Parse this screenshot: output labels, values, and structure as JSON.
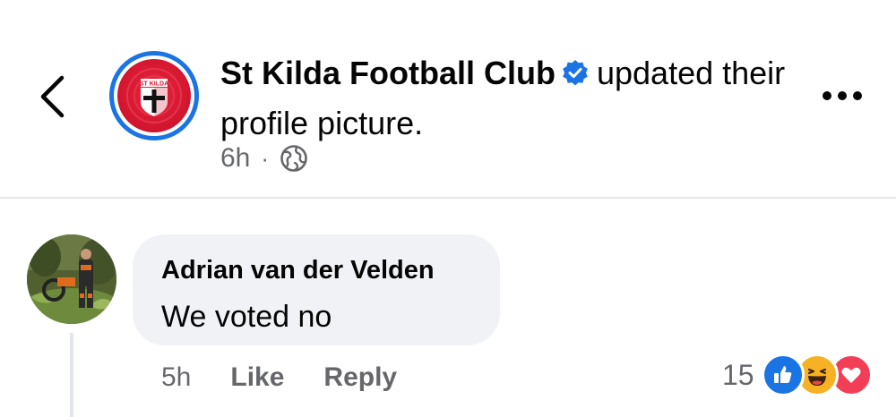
{
  "post_header": {
    "page_name": "St Kilda Football Club",
    "action_text": "updated their profile picture.",
    "timestamp": "6h",
    "separator": "·",
    "privacy_icon": "globe-icon",
    "verified_icon": "verified-badge-icon",
    "back_icon": "chevron-left-icon",
    "more_icon": "more-horizontal-icon",
    "logo_text": "ST KILDA",
    "accent_color": "#1b74e4"
  },
  "comment": {
    "author": "Adrian van der Velden",
    "text": "We voted no",
    "timestamp": "5h",
    "like_label": "Like",
    "reply_label": "Reply",
    "reaction_count": "15",
    "reactions": [
      "like-reaction-icon",
      "haha-reaction-icon",
      "love-reaction-icon"
    ]
  }
}
